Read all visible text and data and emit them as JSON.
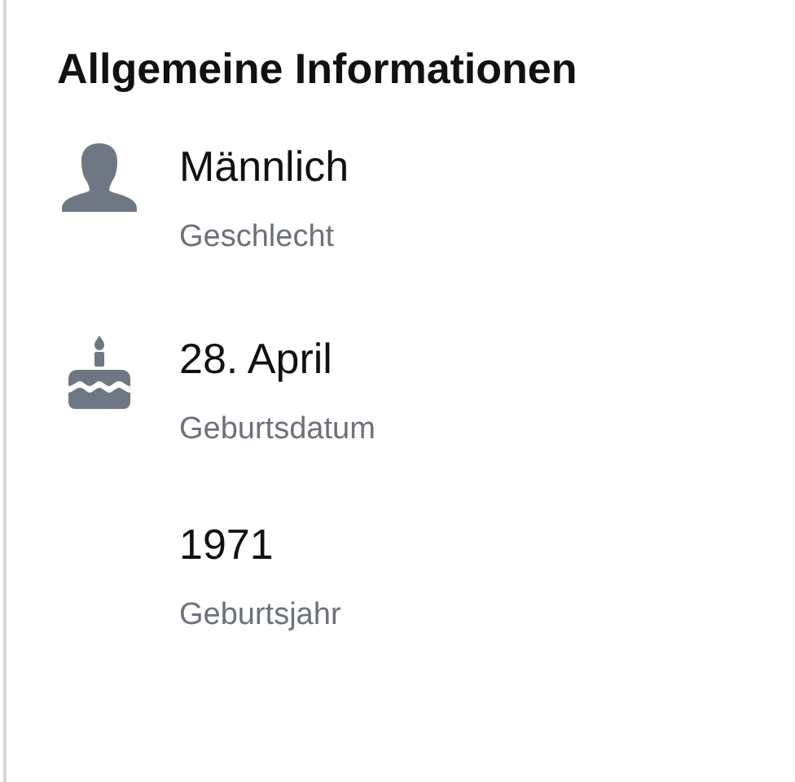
{
  "title": "Allgemeine Informationen",
  "groups": [
    {
      "kind": "person",
      "facts": [
        {
          "value": "Männlich",
          "label": "Geschlecht"
        }
      ]
    },
    {
      "kind": "cake",
      "facts": [
        {
          "value": "28. April",
          "label": "Geburtsdatum"
        },
        {
          "value": "1971",
          "label": "Geburtsjahr"
        }
      ]
    }
  ]
}
